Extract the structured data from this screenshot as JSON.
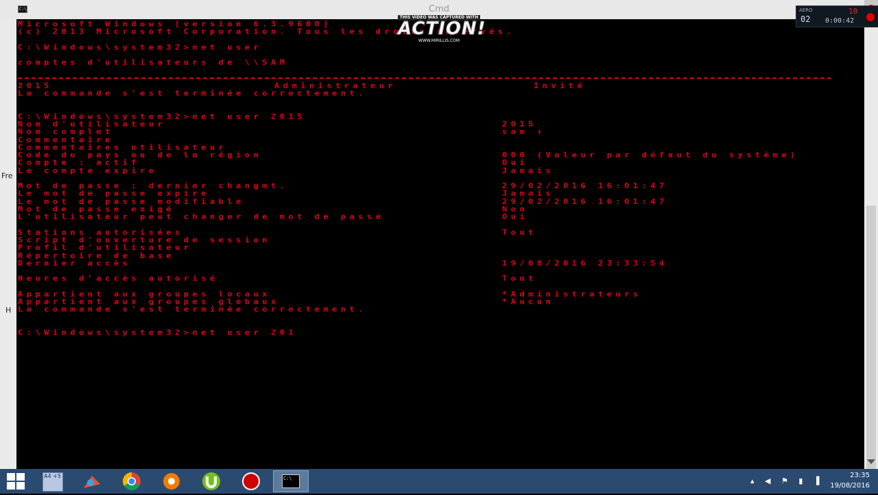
{
  "window": {
    "title": "Cmd",
    "icon_text": "C:\\"
  },
  "left_edge": {
    "label1": "Fre",
    "label2": "H"
  },
  "console": {
    "header_line1": "Microsoft Windows [version 6.3.9600]",
    "header_line2": "(c) 2013 Microsoft Corporation. Tous les droits réservés.",
    "cmd1": "C:\\Windows\\system32>net user",
    "accounts_title": "comptes d'utilisateurs de \\\\SAM",
    "acct1": "2015",
    "acct2": "Administrateur",
    "acct3": "Invité",
    "done1": "La commande s'est terminée correctement.",
    "cmd2": "C:\\Windows\\system32>net user 2015",
    "details": [
      {
        "label": "Nom d'utilisateur",
        "value": "2015"
      },
      {
        "label": "Nom complet",
        "value": "sam ↑"
      },
      {
        "label": "Commentaire",
        "value": ""
      },
      {
        "label": "Commentaires utilisateur",
        "value": ""
      },
      {
        "label": "Code du pays ou de la région",
        "value": "000 (Valeur par défaut du système)"
      },
      {
        "label": "Compte : actif",
        "value": "Oui"
      },
      {
        "label": "Le compte expire",
        "value": "Jamais"
      },
      {
        "label": "Mot de passe : dernier changmt.",
        "value": "29/02/2016 16:01:47"
      },
      {
        "label": "Le mot de passe expire",
        "value": "Jamais"
      },
      {
        "label": "Le mot de passe modifiable",
        "value": "29/02/2016 16:01:47"
      },
      {
        "label": "Mot de passe exigé",
        "value": "Non"
      },
      {
        "label": "L'utilisateur peut changer de mot de passe",
        "value": "Oui"
      },
      {
        "label": "Stations autorisées",
        "value": "Tout"
      },
      {
        "label": "Script d'ouverture de session",
        "value": ""
      },
      {
        "label": "Profil d'utilisateur",
        "value": ""
      },
      {
        "label": "Répertoire de base",
        "value": ""
      },
      {
        "label": "Dernier accès",
        "value": "19/08/2016 23:33:54"
      },
      {
        "label": "Heures d'accès autorisé",
        "value": "Tout"
      },
      {
        "label": "Appartient aux groupes locaux",
        "value": "*Administrateurs"
      },
      {
        "label": "Appartient aux groupes globaux",
        "value": "*Aucun"
      }
    ],
    "done2": "La commande s'est terminée correctement.",
    "cmd3": "C:\\Windows\\system32>net user 201"
  },
  "overlay": {
    "caption": "THIS VIDEO WAS CAPTURED WITH",
    "logo": "ACTION!",
    "url": "WWW.MIRILLIS.COM",
    "aero": "AERO",
    "counter1": "02",
    "counter2": "10",
    "timer": "0:00:42"
  },
  "taskbar": {
    "items": [
      {
        "name": "start-button",
        "icon": "windows-logo-icon"
      },
      {
        "name": "taskbar-app-a4",
        "icon": "document-app-icon"
      },
      {
        "name": "taskbar-app-paint",
        "icon": "paint-icon"
      },
      {
        "name": "taskbar-app-chrome",
        "icon": "chrome-icon"
      },
      {
        "name": "taskbar-app-avast",
        "icon": "avast-icon"
      },
      {
        "name": "taskbar-app-utorrent",
        "icon": "utorrent-icon"
      },
      {
        "name": "taskbar-app-action-recorder",
        "icon": "record-icon"
      },
      {
        "name": "taskbar-app-cmd",
        "icon": "cmd-icon"
      }
    ],
    "a4_label": "A4 +5",
    "time": "23:35",
    "date": "19/08/2016"
  },
  "colors": {
    "console_text": "#e0001b",
    "console_bg": "#000000",
    "taskbar": "#2b4a70"
  }
}
